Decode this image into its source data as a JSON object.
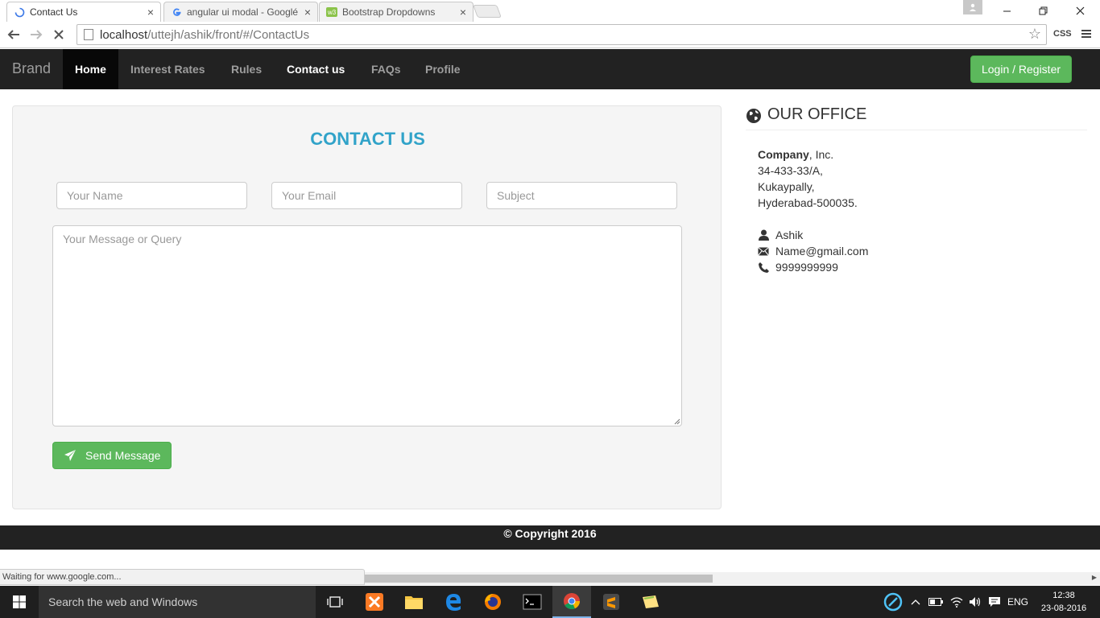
{
  "browser": {
    "tabs": [
      {
        "title": "Contact Us",
        "active": true
      },
      {
        "title": "angular ui modal - Googlé",
        "active": false
      },
      {
        "title": "Bootstrap Dropdowns",
        "active": false
      }
    ],
    "close_glyph": "×",
    "url_host": "localhost",
    "url_path": "/uttejh/ashik/front/#/ContactUs",
    "extension_label": "CSS",
    "status_text": "Waiting for www.google.com..."
  },
  "navbar": {
    "brand": "Brand",
    "links": [
      "Home",
      "Interest Rates",
      "Rules",
      "Contact us",
      "FAQs",
      "Profile"
    ],
    "login_label": "Login / Register"
  },
  "contact": {
    "title": "CONTACT US",
    "name_placeholder": "Your Name",
    "email_placeholder": "Your Email",
    "subject_placeholder": "Subject",
    "message_placeholder": "Your Message or Query",
    "send_label": "Send Message"
  },
  "office": {
    "heading": "OUR OFFICE",
    "company_bold": "Company",
    "company_rest": ", Inc.",
    "address_lines": [
      "34-433-33/A,",
      "Kukaypally,",
      "Hyderabad-500035."
    ],
    "person": "Ashik",
    "email": "Name@gmail.com",
    "phone": "9999999999"
  },
  "footer": {
    "copyright": "© Copyright 2016"
  },
  "taskbar": {
    "search_placeholder": "Search the web and Windows",
    "language": "ENG",
    "time": "12:38",
    "date": "23-08-2016"
  },
  "colors": {
    "navbar_bg": "#222222",
    "accent_blue": "#31a3c9",
    "success_green": "#5cb85c"
  }
}
